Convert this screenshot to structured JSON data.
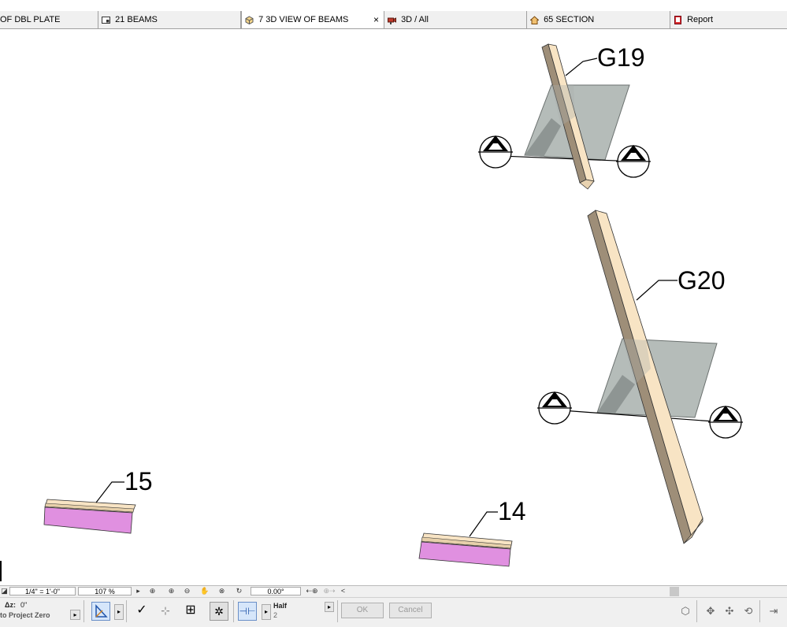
{
  "tabs": [
    {
      "label": "OF DBL PLATE",
      "icon": "floorplan-icon",
      "active": false
    },
    {
      "label": "21 BEAMS",
      "icon": "layout-sheet-icon",
      "active": false
    },
    {
      "label": "7 3D VIEW OF BEAMS",
      "icon": "3d-view-icon",
      "active": true,
      "close": "×"
    },
    {
      "label": "3D / All",
      "icon": "camera-icon",
      "active": false
    },
    {
      "label": "65 SECTION",
      "icon": "section-house-icon",
      "active": false
    },
    {
      "label": "Report",
      "icon": "report-icon",
      "active": false
    }
  ],
  "labels": {
    "g19": "G19",
    "g20": "G20",
    "n15": "15",
    "n14": "14"
  },
  "statusbar": {
    "scale": "1/4\"  =   1'-0\"",
    "zoom": "107 %",
    "angle": "0.00°",
    "scroll_left": "<"
  },
  "infobox": {
    "dz_label": "Δz:",
    "dz_value": "0\"",
    "reference": "to Project Zero",
    "pen_label": "Half",
    "pen_value": "2",
    "ok_label": "OK",
    "cancel_label": "Cancel"
  },
  "colors": {
    "beam_light": "#f8e4c4",
    "beam_dark": "#9e8e78",
    "plate_gray": "#a8b0ad",
    "pink": "#e090e0",
    "tab_bg": "#f0f0f0"
  }
}
